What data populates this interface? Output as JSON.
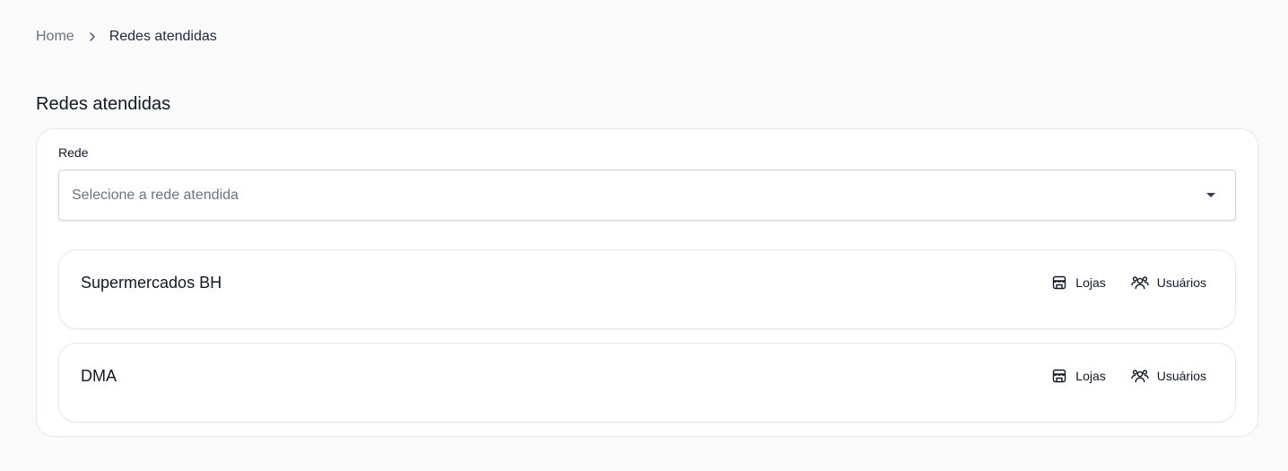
{
  "breadcrumb": {
    "home": "Home",
    "separator_icon": "chevron-right-icon",
    "current": "Redes atendidas"
  },
  "page": {
    "title": "Redes atendidas"
  },
  "filter": {
    "label": "Rede",
    "placeholder": "Selecione a rede atendida",
    "caret_icon": "caret-down-icon"
  },
  "networks": [
    {
      "name": "Supermercados BH",
      "actions": [
        {
          "label": "Lojas",
          "icon": "store-icon"
        },
        {
          "label": "Usuários",
          "icon": "users-icon"
        }
      ]
    },
    {
      "name": "DMA",
      "actions": [
        {
          "label": "Lojas",
          "icon": "store-icon"
        },
        {
          "label": "Usuários",
          "icon": "users-icon"
        }
      ]
    }
  ],
  "colors": {
    "background": "#fafafa",
    "card": "#ffffff",
    "border": "#e5e7eb",
    "muted_text": "#6b7280",
    "text": "#111827"
  }
}
